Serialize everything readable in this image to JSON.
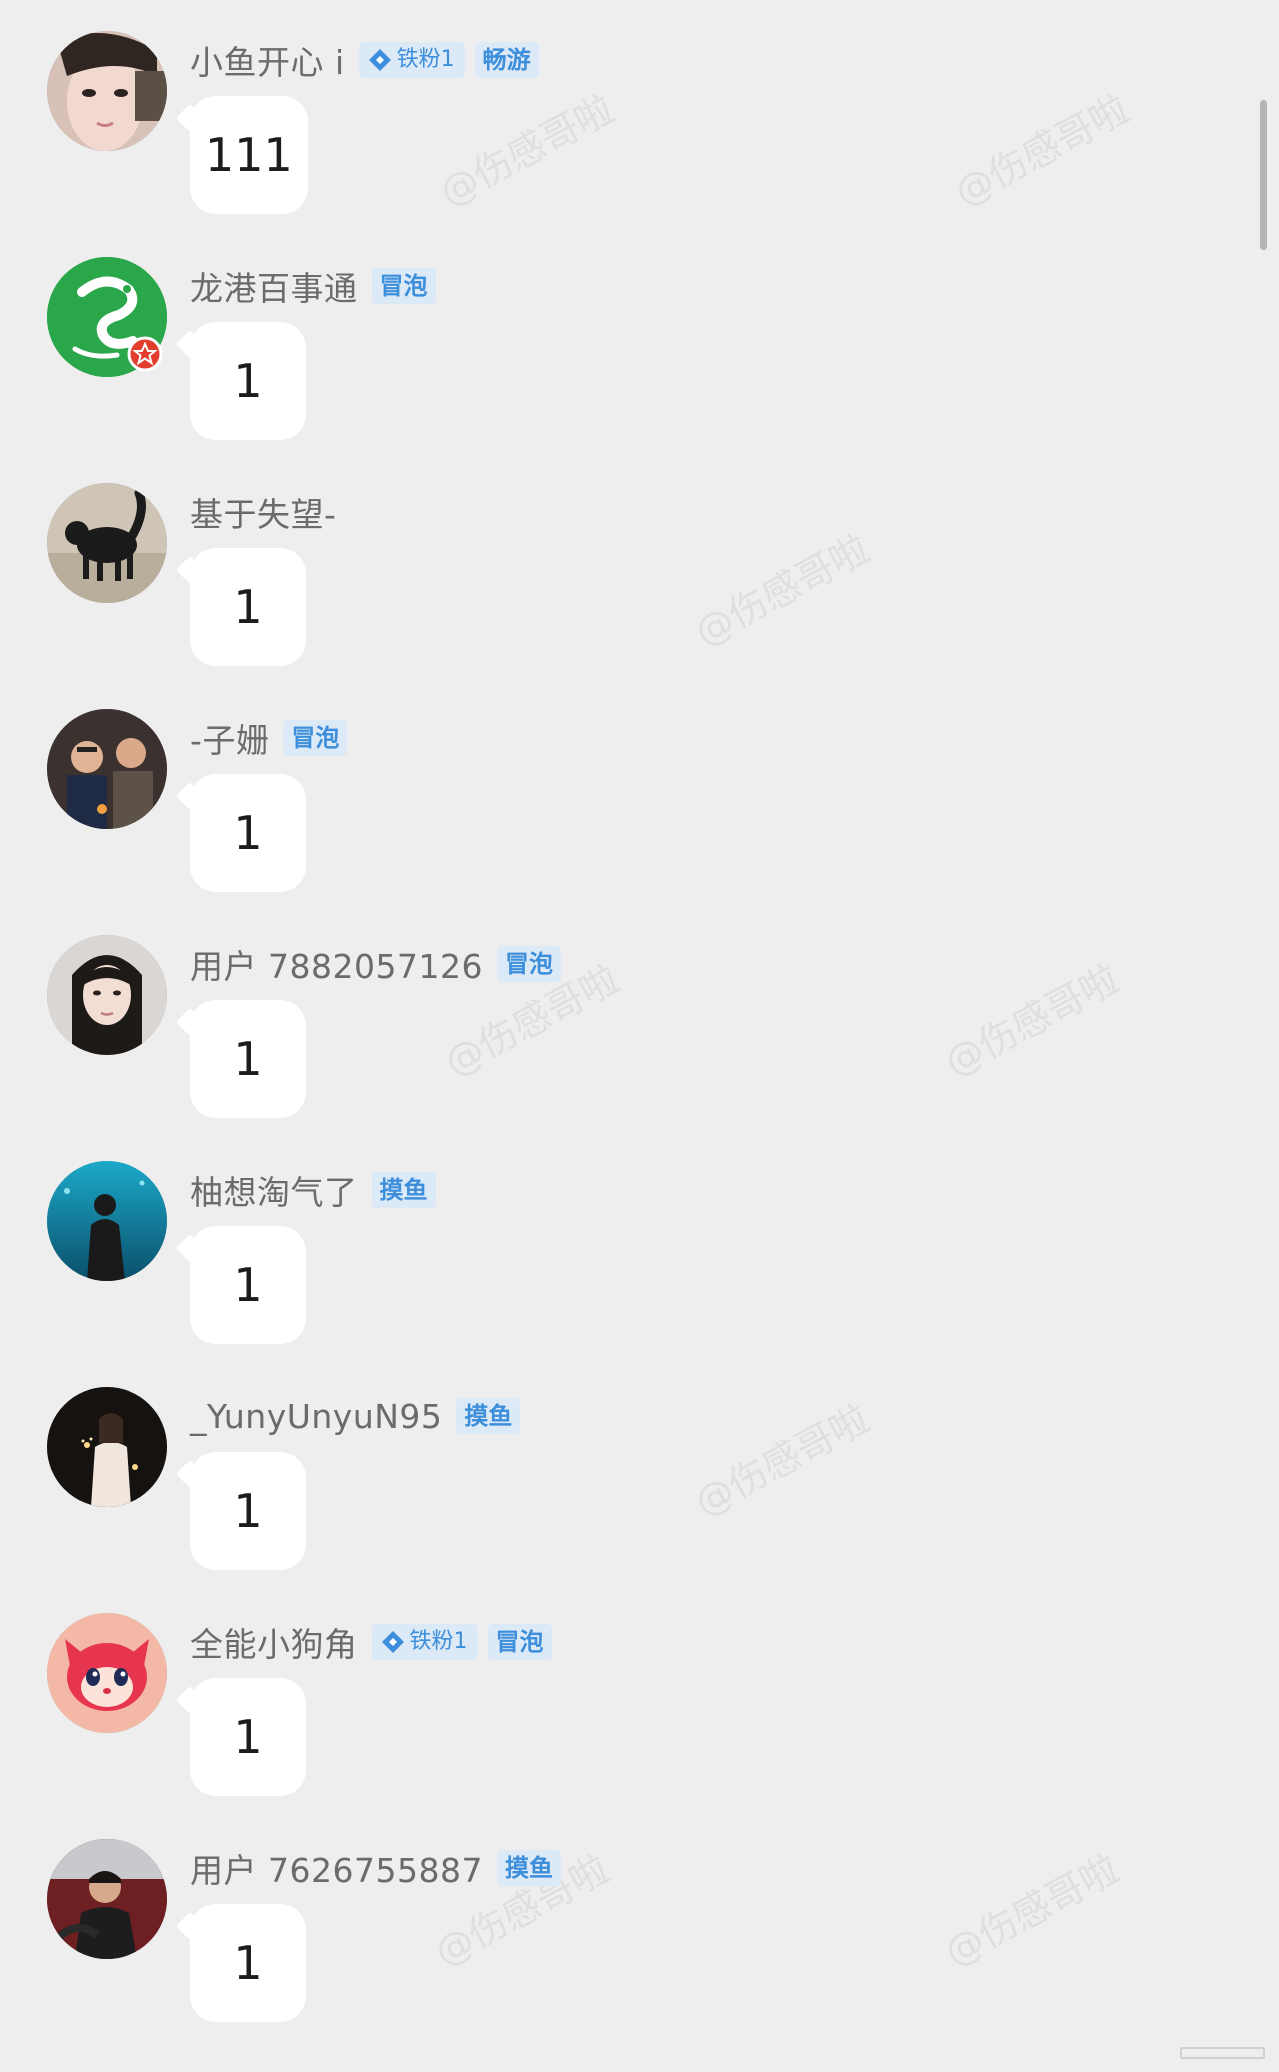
{
  "watermark_text": "@伤感哥啦",
  "colors": {
    "background": "#eeeeee",
    "badge_bg": "#dce9f6",
    "badge_text": "#3d8fdc",
    "username": "#6b6b6b",
    "bubble": "#ffffff"
  },
  "comments": [
    {
      "username": "小鱼开心 i",
      "fan_badge": "铁粉1",
      "level_badge": "畅游",
      "message": "111",
      "avatar_icon": "girl-photo-avatar"
    },
    {
      "username": "龙港百事通",
      "level_badge": "冒泡",
      "message": "1",
      "avatar_icon": "green-dragon-logo-avatar"
    },
    {
      "username": "基于失望-",
      "message": "1",
      "avatar_icon": "black-cat-avatar"
    },
    {
      "username": "-子姗",
      "level_badge": "冒泡",
      "message": "1",
      "avatar_icon": "group-photo-avatar"
    },
    {
      "username": "用户 7882057126",
      "level_badge": "冒泡",
      "message": "1",
      "avatar_icon": "portrait-avatar"
    },
    {
      "username": "柚想淘气了",
      "level_badge": "摸鱼",
      "message": "1",
      "avatar_icon": "aquarium-avatar"
    },
    {
      "username": "_YunyUnyuN95",
      "level_badge": "摸鱼",
      "message": "1",
      "avatar_icon": "sparkler-night-avatar"
    },
    {
      "username": "全能小狗角",
      "fan_badge": "铁粉1",
      "level_badge": "冒泡",
      "message": "1",
      "avatar_icon": "pink-cartoon-fox-avatar"
    },
    {
      "username": "用户 7626755887",
      "level_badge": "摸鱼",
      "message": "1",
      "avatar_icon": "car-selfie-avatar"
    }
  ]
}
